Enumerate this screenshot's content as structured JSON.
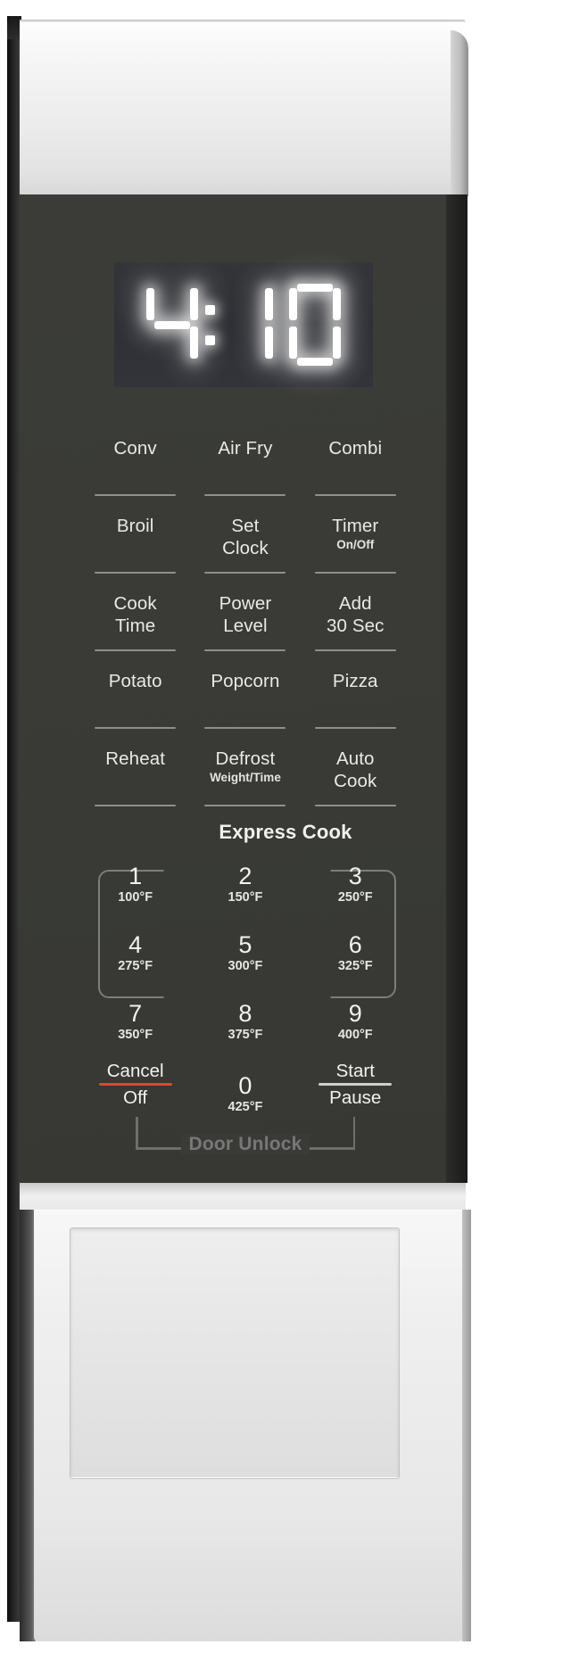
{
  "device": {
    "type": "microwave-control-panel",
    "colors": {
      "panel_face": "#3a3b37",
      "trim": "#eeeeee",
      "led_white": "#ffffff",
      "cancel_red": "#e0453a",
      "divider_grey": "#8f8f8b",
      "unlock_grey": "#78787a"
    }
  },
  "display": {
    "value": "4:10",
    "digits": [
      "4",
      ":",
      "1",
      "0"
    ]
  },
  "function_buttons": [
    [
      {
        "label": "Conv",
        "sub": ""
      },
      {
        "label": "Air Fry",
        "sub": ""
      },
      {
        "label": "Combi",
        "sub": ""
      }
    ],
    [
      {
        "label": "Broil",
        "sub": ""
      },
      {
        "label": "Set\nClock",
        "sub": ""
      },
      {
        "label": "Timer",
        "sub": "On/Off"
      }
    ],
    [
      {
        "label": "Cook\nTime",
        "sub": ""
      },
      {
        "label": "Power\nLevel",
        "sub": ""
      },
      {
        "label": "Add\n30 Sec",
        "sub": ""
      }
    ],
    [
      {
        "label": "Potato",
        "sub": ""
      },
      {
        "label": "Popcorn",
        "sub": ""
      },
      {
        "label": "Pizza",
        "sub": ""
      }
    ],
    [
      {
        "label": "Reheat",
        "sub": ""
      },
      {
        "label": "Defrost",
        "sub": "Weight/Time"
      },
      {
        "label": "Auto\nCook",
        "sub": ""
      }
    ]
  ],
  "express_cook": {
    "title": "Express Cook",
    "keys": [
      [
        {
          "num": "1",
          "temp": "100°F"
        },
        {
          "num": "2",
          "temp": "150°F"
        },
        {
          "num": "3",
          "temp": "250°F"
        }
      ],
      [
        {
          "num": "4",
          "temp": "275°F"
        },
        {
          "num": "5",
          "temp": "300°F"
        },
        {
          "num": "6",
          "temp": "325°F"
        }
      ],
      [
        {
          "num": "7",
          "temp": "350°F"
        },
        {
          "num": "8",
          "temp": "375°F"
        },
        {
          "num": "9",
          "temp": "400°F"
        }
      ]
    ]
  },
  "action_row": {
    "cancel": {
      "top": "Cancel",
      "bottom": "Off"
    },
    "zero": {
      "num": "0",
      "temp": "425°F"
    },
    "start": {
      "top": "Start",
      "bottom": "Pause"
    }
  },
  "door_unlock": {
    "label": "Door Unlock"
  }
}
